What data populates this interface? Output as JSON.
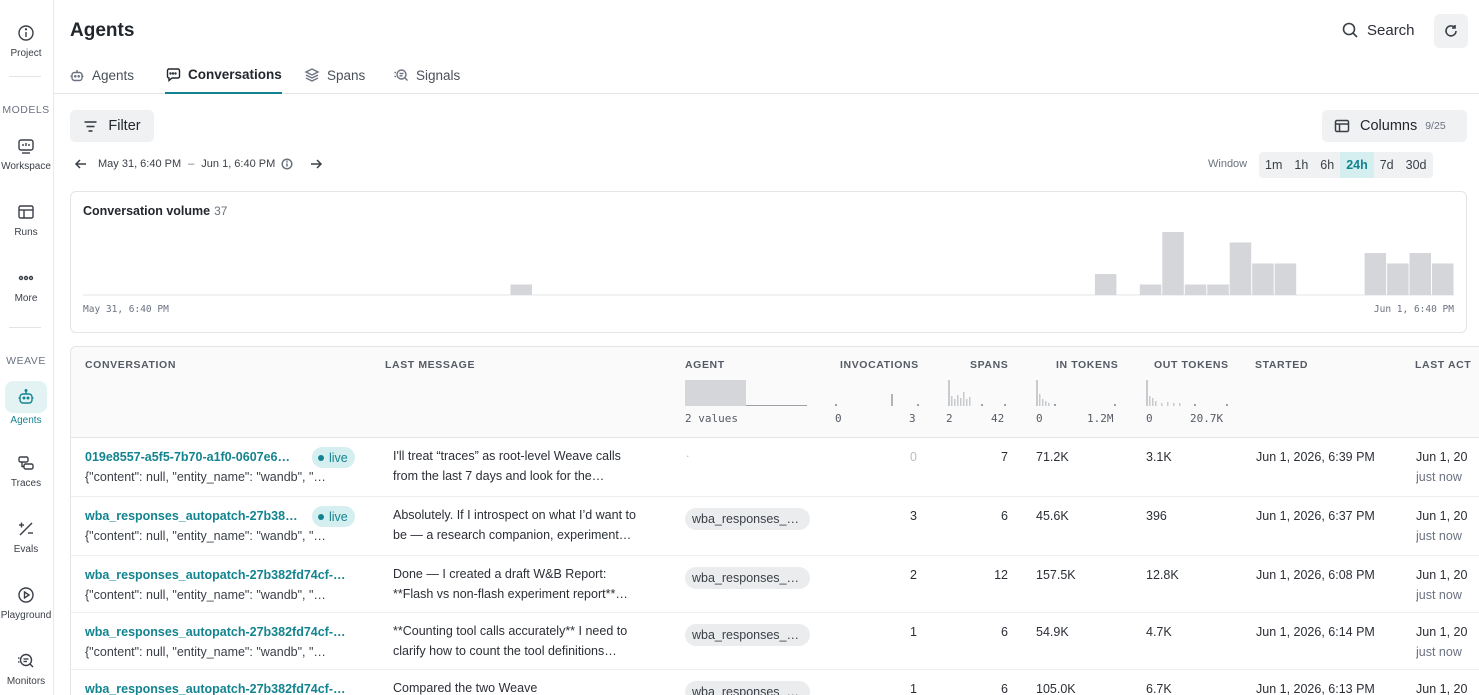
{
  "rail": {
    "project": "Project",
    "models_section": "MODELS",
    "workspace": "Workspace",
    "runs": "Runs",
    "more": "More",
    "weave_section": "WEAVE",
    "agents": "Agents",
    "traces": "Traces",
    "evals": "Evals",
    "playground": "Playground",
    "monitors": "Monitors"
  },
  "header": {
    "title": "Agents",
    "search_label": "Search"
  },
  "tabs": [
    {
      "label": "Agents",
      "icon": "robot-icon",
      "active": false
    },
    {
      "label": "Conversations",
      "icon": "chat-icon",
      "active": true
    },
    {
      "label": "Spans",
      "icon": "layers-icon",
      "active": false
    },
    {
      "label": "Signals",
      "icon": "signals-icon",
      "active": false
    }
  ],
  "toolbar": {
    "filter_label": "Filter",
    "columns_label": "Columns",
    "columns_count": "9/25",
    "range_start": "May 31, 6:40 PM",
    "range_sep": "–",
    "range_end": "Jun 1, 6:40 PM",
    "window_label": "Window",
    "windows": [
      "1m",
      "1h",
      "6h",
      "24h",
      "7d",
      "30d"
    ],
    "active_window": "24h"
  },
  "chart_data": {
    "type": "bar",
    "title": "Conversation volume",
    "total": "37",
    "x_start_label": "May 31, 6:40 PM",
    "x_end_label": "Jun 1, 6:40 PM",
    "bins": 60,
    "values": [
      0,
      0,
      0,
      0,
      0,
      0,
      0,
      0,
      0,
      0,
      0,
      0,
      0,
      0,
      0,
      0,
      0,
      0,
      0,
      1,
      0,
      0,
      0,
      0,
      0,
      0,
      0,
      0,
      0,
      0,
      0,
      0,
      0,
      0,
      0,
      0,
      0,
      0,
      0,
      0,
      0,
      0,
      0,
      0,
      0,
      2,
      0,
      1,
      6,
      1,
      1,
      5,
      3,
      3,
      0,
      0,
      0,
      4,
      3,
      4,
      3
    ],
    "bar_color": "#d4d6da",
    "ylim": [
      0,
      6
    ]
  },
  "table": {
    "headers": {
      "conversation": "CONVERSATION",
      "last_message": "LAST MESSAGE",
      "agent": "AGENT",
      "invocations": "INVOCATIONS",
      "spans": "SPANS",
      "in_tokens": "IN TOKENS",
      "out_tokens": "OUT TOKENS",
      "started": "STARTED",
      "last_activity": "LAST ACT"
    },
    "summaries": {
      "agent": "2 values",
      "invocations_min": "0",
      "invocations_max": "3",
      "spans_min": "2",
      "spans_max": "42",
      "in_tokens_min": "0",
      "in_tokens_max": "1.2M",
      "out_tokens_min": "0",
      "out_tokens_max": "20.7K"
    },
    "live_label": "live",
    "rows": [
      {
        "id": "019e8557-a5f5-7b70-a1f0-0607e6…",
        "sub": "{\"content\": null, \"entity_name\": \"wandb\", \"…",
        "live": true,
        "msg1": "I'll treat “traces” as root-level Weave calls",
        "msg2": "from the last 7 days and look for the…",
        "agent": "",
        "agent_placeholder": ".",
        "invocations": "0",
        "spans": "7",
        "in_tokens": "71.2K",
        "out_tokens": "3.1K",
        "started": "Jun 1, 2026, 6:39 PM",
        "last1": "Jun 1, 20",
        "last2": "just now"
      },
      {
        "id": "wba_responses_autopatch-27b38…",
        "sub": "{\"content\": null, \"entity_name\": \"wandb\", \"…",
        "live": true,
        "msg1": "Absolutely. If I introspect on what I’d want to",
        "msg2": "be — a research companion, experiment…",
        "agent": "wba_responses_…",
        "invocations": "3",
        "spans": "6",
        "in_tokens": "45.6K",
        "out_tokens": "396",
        "started": "Jun 1, 2026, 6:37 PM",
        "last1": "Jun 1, 20",
        "last2": "just now"
      },
      {
        "id": "wba_responses_autopatch-27b382fd74cf-…",
        "sub": "{\"content\": null, \"entity_name\": \"wandb\", \"…",
        "live": false,
        "msg1": "Done — I created a draft W&B Report:",
        "msg2": "**Flash vs non-flash experiment report**…",
        "agent": "wba_responses_…",
        "invocations": "2",
        "spans": "12",
        "in_tokens": "157.5K",
        "out_tokens": "12.8K",
        "started": "Jun 1, 2026, 6:08 PM",
        "last1": "Jun 1, 20",
        "last2": "just now"
      },
      {
        "id": "wba_responses_autopatch-27b382fd74cf-…",
        "sub": "{\"content\": null, \"entity_name\": \"wandb\", \"…",
        "live": false,
        "msg1": "**Counting tool calls accurately** I need to",
        "msg2": "clarify how to count the tool definitions…",
        "agent": "wba_responses_…",
        "invocations": "1",
        "spans": "6",
        "in_tokens": "54.9K",
        "out_tokens": "4.7K",
        "started": "Jun 1, 2026, 6:14 PM",
        "last1": "Jun 1, 20",
        "last2": "just now"
      },
      {
        "id": "wba_responses_autopatch-27b382fd74cf-…",
        "sub": "",
        "live": false,
        "msg1": "Compared the two Weave",
        "msg2": "",
        "agent": "wba_responses_…",
        "invocations": "1",
        "spans": "6",
        "in_tokens": "105.0K",
        "out_tokens": "6.7K",
        "started": "Jun 1, 2026, 6:13 PM",
        "last1": "Jun 1, 20",
        "last2": ""
      }
    ]
  }
}
